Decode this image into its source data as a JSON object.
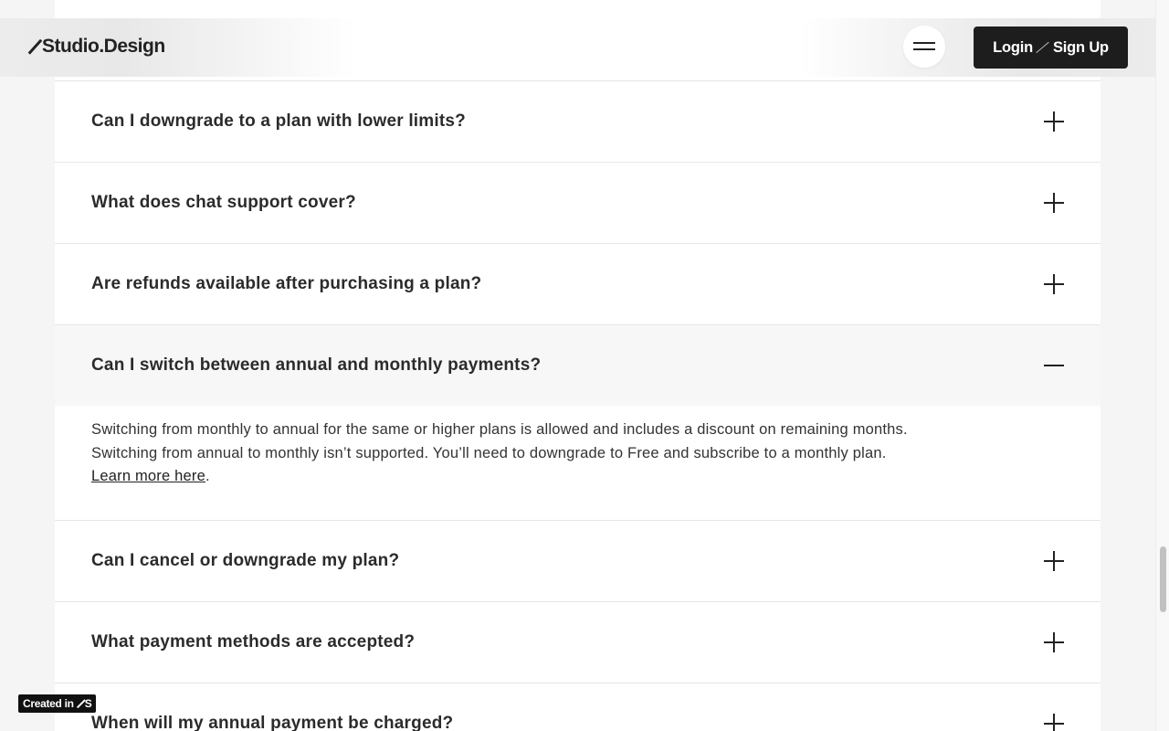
{
  "header": {
    "logo_text": "Studio.Design",
    "login_label": "Login",
    "signup_label": "Sign Up"
  },
  "faq": {
    "items": [
      {
        "question": "Can I downgrade to a plan with lower limits?"
      },
      {
        "question": "What does chat support cover?"
      },
      {
        "question": "Are refunds available after purchasing a plan?"
      },
      {
        "question": "Can I switch between annual and monthly payments?",
        "answer_line1": "Switching from monthly to annual for the same or higher plans is allowed and includes a discount on remaining months.",
        "answer_line2": "Switching from annual to monthly isn’t supported. You’ll need to downgrade to Free and subscribe to a monthly plan.",
        "answer_link": "Learn more here",
        "answer_suffix": "."
      },
      {
        "question": "Can I cancel or downgrade my plan?"
      },
      {
        "question": "What payment methods are accepted?"
      },
      {
        "question": "When will my annual payment be charged?"
      }
    ]
  },
  "badge": {
    "label": "Created in",
    "suffix": "S"
  },
  "icons": {
    "expand": "plus-icon",
    "collapse": "minus-icon",
    "menu": "hamburger-icon"
  },
  "colors": {
    "accent_dark": "#1d1d1d",
    "page_bg": "#f5f5f5",
    "panel_bg": "#ffffff",
    "open_row_bg": "#f7f7f7"
  }
}
